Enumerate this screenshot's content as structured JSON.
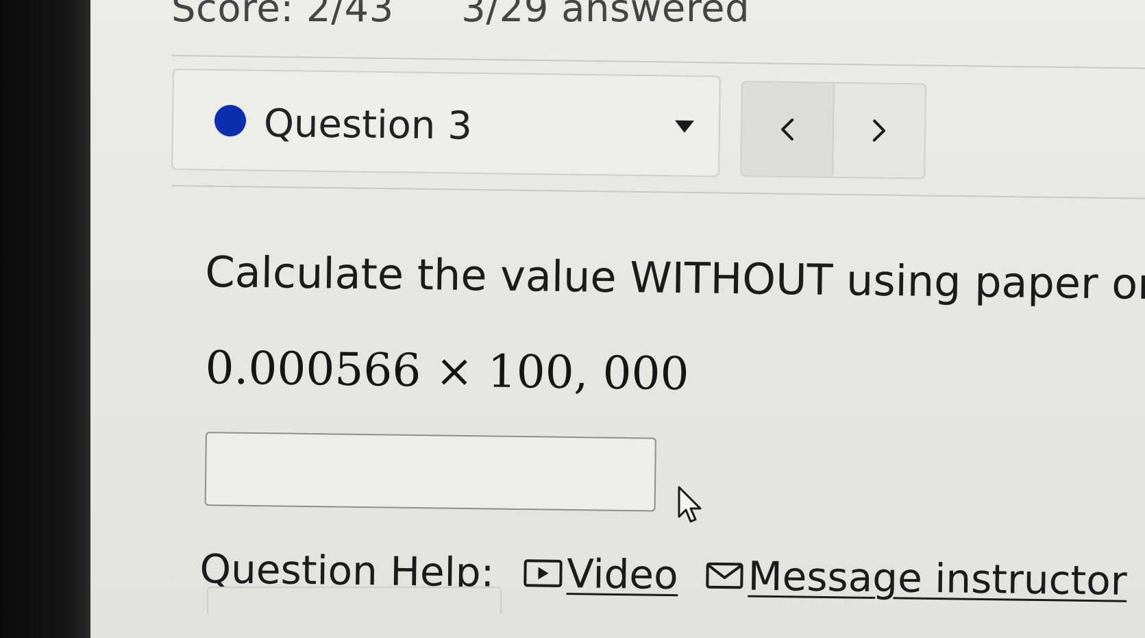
{
  "header": {
    "score": "Score: 2/43",
    "answered": "3/29 answered"
  },
  "question_selector": {
    "label": "Question 3",
    "status_color": "#0b2fb0"
  },
  "navigation": {
    "prev_icon": "chevron-left-icon",
    "next_icon": "chevron-right-icon"
  },
  "question": {
    "prompt": "Calculate the value WITHOUT using paper or",
    "expression": "0.000566 × 100, 000"
  },
  "answer_input": {
    "value": "",
    "placeholder": ""
  },
  "help": {
    "label": "Question Help:",
    "links": [
      {
        "label": "Video",
        "icon": "video-icon"
      },
      {
        "label": "Message instructor",
        "icon": "envelope-icon"
      }
    ]
  }
}
